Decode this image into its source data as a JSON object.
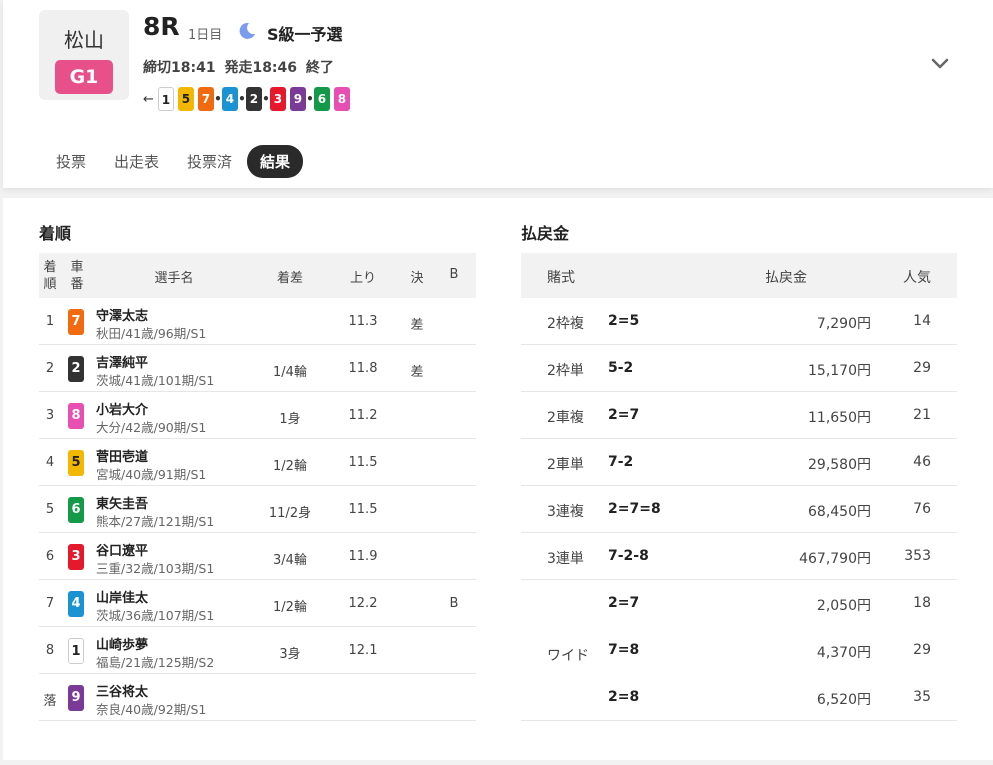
{
  "header": {
    "venue": "松山",
    "grade": "G1",
    "race_no": "8R",
    "day": "1日目",
    "race_class": "S級一予選",
    "deadline": "締切18:41",
    "start": "発走18:46",
    "status": "終了",
    "line_arrow": "←"
  },
  "line_chips": [
    {
      "num": "1",
      "bg": "#ffffff",
      "fg": "#222222",
      "border": "#cccccc"
    },
    {
      "num": "5",
      "bg": "#f2b800",
      "fg": "#222222"
    },
    {
      "num": "7",
      "bg": "#f26a10",
      "fg": "#ffffff"
    },
    {
      "num": "4",
      "bg": "#1a93d3",
      "fg": "#ffffff"
    },
    {
      "num": "2",
      "bg": "#333333",
      "fg": "#ffffff"
    },
    {
      "num": "3",
      "bg": "#e6192c",
      "fg": "#ffffff"
    },
    {
      "num": "9",
      "bg": "#7b3a96",
      "fg": "#ffffff"
    },
    {
      "num": "6",
      "bg": "#139a48",
      "fg": "#ffffff"
    },
    {
      "num": "8",
      "bg": "#e84fb3",
      "fg": "#ffffff"
    }
  ],
  "tabs": [
    "投票",
    "出走表",
    "投票済",
    "結果"
  ],
  "active_tab": "結果",
  "results": {
    "title": "着順",
    "headers": {
      "rank_1": "着",
      "rank_2": "順",
      "car_1": "車",
      "car_2": "番",
      "name": "選手名",
      "margin": "着差",
      "last": "上り",
      "kimari": "決",
      "b": "B"
    },
    "rows": [
      {
        "rank": "1",
        "car": "7",
        "name": "守澤太志",
        "sub": "秋田/41歳/96期/S1",
        "margin": "",
        "last": "11.3",
        "kimari": "差",
        "b": ""
      },
      {
        "rank": "2",
        "car": "2",
        "name": "吉澤純平",
        "sub": "茨城/41歳/101期/S1",
        "margin": "1/4輪",
        "last": "11.8",
        "kimari": "差",
        "b": ""
      },
      {
        "rank": "3",
        "car": "8",
        "name": "小岩大介",
        "sub": "大分/42歳/90期/S1",
        "margin": "1身",
        "last": "11.2",
        "kimari": "",
        "b": ""
      },
      {
        "rank": "4",
        "car": "5",
        "name": "菅田壱道",
        "sub": "宮城/40歳/91期/S1",
        "margin": "1/2輪",
        "last": "11.5",
        "kimari": "",
        "b": ""
      },
      {
        "rank": "5",
        "car": "6",
        "name": "東矢圭吾",
        "sub": "熊本/27歳/121期/S1",
        "margin": "11/2身",
        "last": "11.5",
        "kimari": "",
        "b": ""
      },
      {
        "rank": "6",
        "car": "3",
        "name": "谷口遼平",
        "sub": "三重/32歳/103期/S1",
        "margin": "3/4輪",
        "last": "11.9",
        "kimari": "",
        "b": ""
      },
      {
        "rank": "7",
        "car": "4",
        "name": "山岸佳太",
        "sub": "茨城/36歳/107期/S1",
        "margin": "1/2輪",
        "last": "12.2",
        "kimari": "",
        "b": "B"
      },
      {
        "rank": "8",
        "car": "1",
        "name": "山崎歩夢",
        "sub": "福島/21歳/125期/S2",
        "margin": "3身",
        "last": "12.1",
        "kimari": "",
        "b": ""
      },
      {
        "rank": "落",
        "car": "9",
        "name": "三谷将太",
        "sub": "奈良/40歳/92期/S1",
        "margin": "",
        "last": "",
        "kimari": "",
        "b": ""
      }
    ]
  },
  "payout": {
    "title": "払戻金",
    "headers": {
      "type": "賭式",
      "amount": "払戻金",
      "popularity": "人気"
    },
    "rows": [
      {
        "type": "2枠複",
        "combo": "2=5",
        "amount": "7,290円",
        "pop": "14"
      },
      {
        "type": "2枠単",
        "combo": "5-2",
        "amount": "15,170円",
        "pop": "29"
      },
      {
        "type": "2車複",
        "combo": "2=7",
        "amount": "11,650円",
        "pop": "21"
      },
      {
        "type": "2車単",
        "combo": "7-2",
        "amount": "29,580円",
        "pop": "46"
      },
      {
        "type": "3連複",
        "combo": "2=7=8",
        "amount": "68,450円",
        "pop": "76"
      },
      {
        "type": "3連単",
        "combo": "7-2-8",
        "amount": "467,790円",
        "pop": "353"
      },
      {
        "type": "",
        "combo": "2=7",
        "amount": "2,050円",
        "pop": "18"
      },
      {
        "type": "",
        "combo": "7=8",
        "amount": "4,370円",
        "pop": "29"
      },
      {
        "type": "",
        "combo": "2=8",
        "amount": "6,520円",
        "pop": "35"
      }
    ],
    "wide_label": "ワイド"
  },
  "car_colors": {
    "1": {
      "bg": "#ffffff",
      "fg": "#222222",
      "border": "#cccccc"
    },
    "2": {
      "bg": "#333333",
      "fg": "#ffffff"
    },
    "3": {
      "bg": "#e6192c",
      "fg": "#ffffff"
    },
    "4": {
      "bg": "#1a93d3",
      "fg": "#ffffff"
    },
    "5": {
      "bg": "#f2b800",
      "fg": "#222222"
    },
    "6": {
      "bg": "#139a48",
      "fg": "#ffffff"
    },
    "7": {
      "bg": "#f26a10",
      "fg": "#ffffff"
    },
    "8": {
      "bg": "#e84fb3",
      "fg": "#ffffff"
    },
    "9": {
      "bg": "#7b3a96",
      "fg": "#ffffff"
    }
  },
  "icons": {
    "moon": "moon-icon",
    "chevron": "chevron-down-icon",
    "arrow": "arrow-left-icon"
  }
}
